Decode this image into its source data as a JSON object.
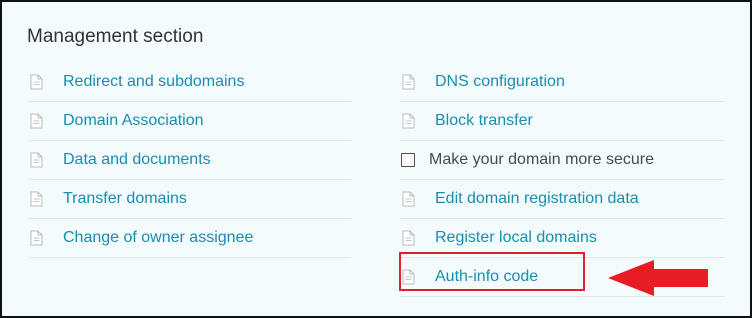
{
  "section": {
    "title": "Management section"
  },
  "left_items": [
    {
      "label": "Redirect and subdomains",
      "icon": "document-icon"
    },
    {
      "label": "Domain Association",
      "icon": "document-icon"
    },
    {
      "label": "Data and documents",
      "icon": "document-icon"
    },
    {
      "label": "Transfer domains",
      "icon": "document-icon"
    },
    {
      "label": "Change of owner assignee",
      "icon": "document-icon"
    }
  ],
  "right_items": [
    {
      "label": "DNS configuration",
      "icon": "document-icon"
    },
    {
      "label": "Block transfer",
      "icon": "document-icon"
    },
    {
      "label": "Make your domain more secure",
      "icon": "checkbox",
      "checked": false
    },
    {
      "label": "Edit domain registration data",
      "icon": "document-icon"
    },
    {
      "label": "Register local domains",
      "icon": "document-icon"
    },
    {
      "label": "Auth-info code",
      "icon": "document-icon"
    }
  ],
  "colors": {
    "link": "#1a8db0",
    "background": "#f3fbfd",
    "highlight": "#e0202b",
    "arrow": "#e81c24"
  }
}
